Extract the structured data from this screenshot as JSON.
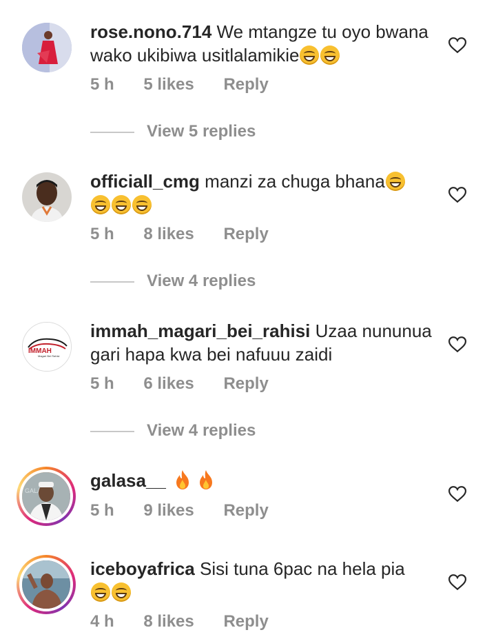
{
  "comments": [
    {
      "username": "rose.nono.714",
      "text": "We mtangze tu oyo bwana wako ukibiwa usitlalamikie",
      "emoji_count": 2,
      "time": "5 h",
      "likes": "5 likes",
      "reply": "Reply",
      "view_replies": "View 5 replies",
      "avatar_icon": "avatar-photo-red-dress"
    },
    {
      "username": "officiall_cmg",
      "text": "manzi za chuga bhana",
      "emoji_count": 4,
      "time": "5 h",
      "likes": "8 likes",
      "reply": "Reply",
      "view_replies": "View 4 replies",
      "avatar_icon": "avatar-photo-man"
    },
    {
      "username": "immah_magari_bei_rahisi",
      "text": "Uzaa nununua gari hapa kwa bei nafuuu zaidi",
      "emoji_count": 0,
      "time": "5 h",
      "likes": "6 likes",
      "reply": "Reply",
      "view_replies": "View 4 replies",
      "avatar_icon": "avatar-logo-car",
      "logo_text": "IMMAH",
      "logo_subtext": "Magari Bei Rahisi"
    },
    {
      "username": "galasa__",
      "text": "",
      "emoji_count": 0,
      "fire_count": 2,
      "time": "5 h",
      "likes": "9 likes",
      "reply": "Reply",
      "avatar_icon": "avatar-photo-man-cap",
      "avatar_watermark": "GALASA"
    },
    {
      "username": "iceboyafrica",
      "text": "Sisi tuna 6pac na hela pia",
      "emoji_count": 2,
      "time": "4 h",
      "likes": "8 likes",
      "reply": "Reply",
      "avatar_icon": "avatar-photo-shirtless"
    }
  ],
  "colors": {
    "text": "#262626",
    "meta": "#8e8e8e",
    "divider": "#c7c7c7",
    "story_ring": [
      "#f58529",
      "#dd2a7b",
      "#8134af",
      "#feda77"
    ]
  }
}
